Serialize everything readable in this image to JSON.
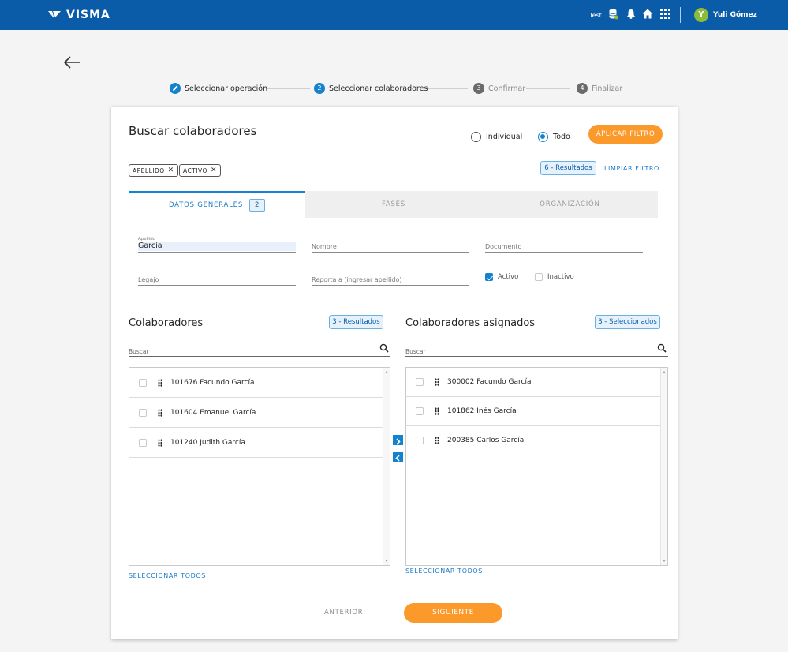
{
  "header": {
    "logo_text": "VISMA",
    "env_label": "Test",
    "user_initial": "Y",
    "user_name": "Yuli Gómez"
  },
  "steps": [
    {
      "number": "",
      "label": "Seleccionar operación",
      "state": "done"
    },
    {
      "number": "2",
      "label": "Seleccionar colaboradores",
      "state": "active"
    },
    {
      "number": "3",
      "label": "Confirmar",
      "state": "pending"
    },
    {
      "number": "4",
      "label": "Finalizar",
      "state": "pending"
    }
  ],
  "search_panel": {
    "title": "Buscar colaboradores",
    "radio_individual": "Individual",
    "radio_todo": "Todo",
    "radio_selected": "Todo",
    "apply_filter": "APLICAR FILTRO",
    "chips": [
      "APELLIDO",
      "ACTIVO"
    ],
    "results_badge": "6 - Resultados",
    "clear_filter": "LIMPIAR FILTRO"
  },
  "tabs": [
    {
      "label": "DATOS GENERALES",
      "count": "2",
      "active": true
    },
    {
      "label": "FASES",
      "count": "",
      "active": false
    },
    {
      "label": "ORGANIZACIÓN",
      "count": "",
      "active": false
    }
  ],
  "form": {
    "apellido_label": "Apellido",
    "apellido_value": "García",
    "nombre_label": "Nombre",
    "documento_label": "Documento",
    "legajo_label": "Legajo",
    "reporta_label": "Reporta a (ingresar apellido)",
    "activo_label": "Activo",
    "activo_checked": true,
    "inactivo_label": "Inactivo",
    "inactivo_checked": false
  },
  "colaboradores": {
    "title": "Colaboradores",
    "badge": "3 - Resultados",
    "search_placeholder": "Buscar",
    "items": [
      "101676 Facundo García",
      "101604 Emanuel García",
      "101240 Judith García"
    ],
    "select_all": "SELECCIONAR TODOS"
  },
  "asignados": {
    "title": "Colaboradores asignados",
    "badge": "3 - Seleccionados",
    "search_placeholder": "Buscar",
    "items": [
      "300002 Facundo García",
      "101862 Inés García",
      "200385 Carlos García"
    ],
    "select_all": "SELECCIONAR TODOS"
  },
  "footer": {
    "prev": "ANTERIOR",
    "next": "SIGUIENTE"
  },
  "colors": {
    "header_blue": "#0a5ba8",
    "accent_blue": "#1482cc",
    "orange": "#fb9a2b"
  }
}
